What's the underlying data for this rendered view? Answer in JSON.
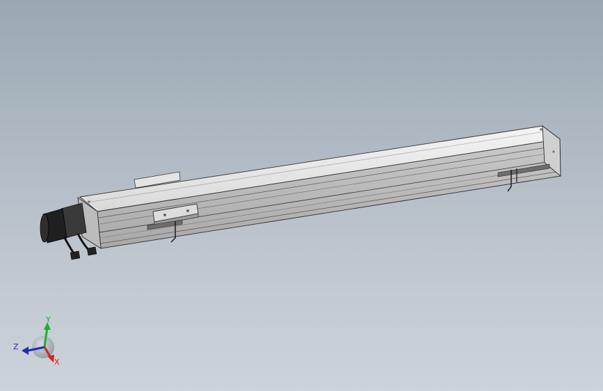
{
  "viewport": {
    "background_top": "#9aa7b3",
    "background_bottom": "#cdd3da",
    "model": "linear-actuator-assembly"
  },
  "triad": {
    "x_label": "X",
    "y_label": "Y",
    "z_label": "Z",
    "x_color": "#d62020",
    "y_color": "#1fae2b",
    "z_color": "#1c2fb0"
  }
}
